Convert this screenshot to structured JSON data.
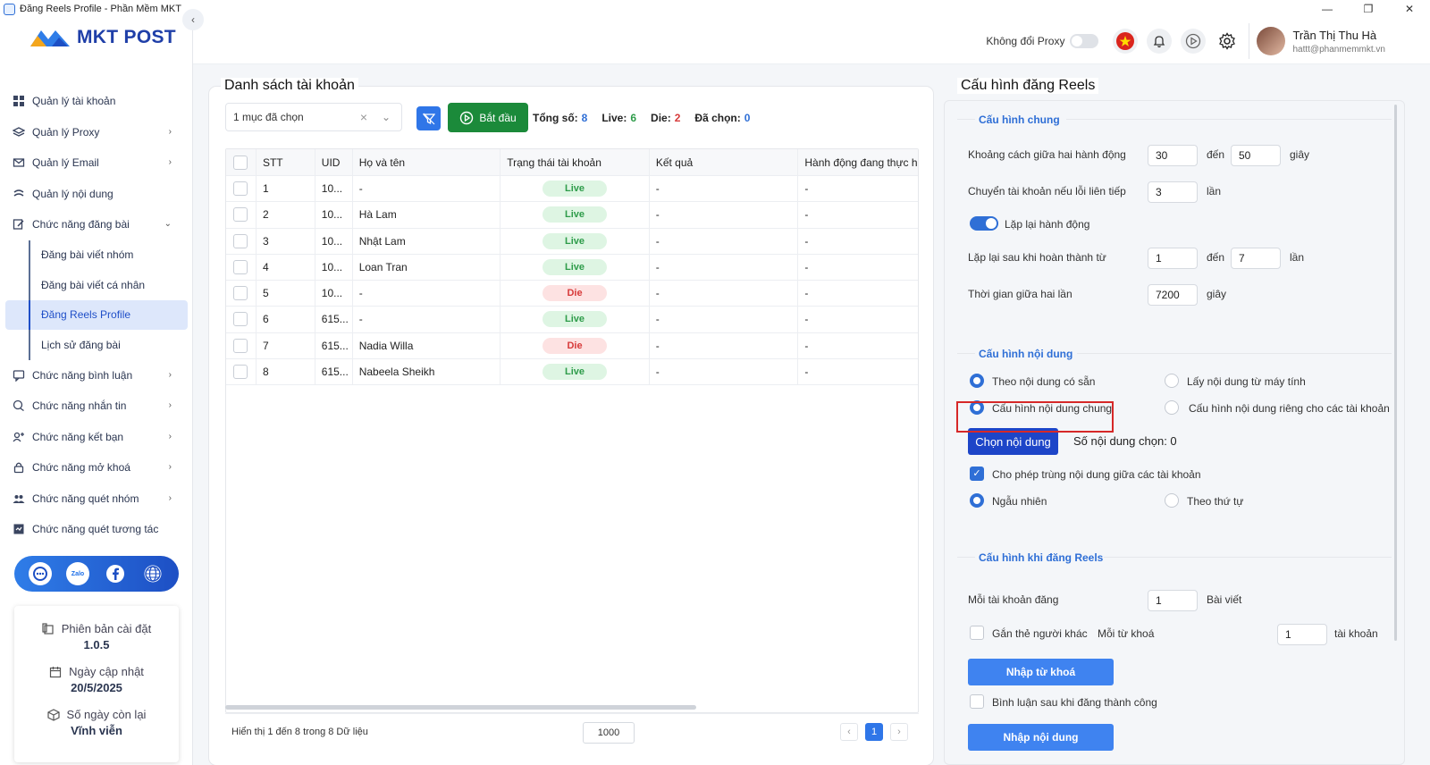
{
  "window": {
    "title": "Đăng Reels Profile - Phần Mềm MKT",
    "controls": [
      "—",
      "❐",
      "✕"
    ]
  },
  "brand": {
    "logo_text": "MKT POST",
    "colors": {
      "primary": "#2f6fd6",
      "green": "#1b8a3a",
      "live": "#2e9c4a",
      "die": "#d73a3a"
    }
  },
  "sidebar": {
    "items": [
      {
        "label": "Quản lý tài khoản",
        "icon": "grid-icon",
        "chevron": false
      },
      {
        "label": "Quản lý Proxy",
        "icon": "layers-icon",
        "chevron": true
      },
      {
        "label": "Quản lý Email",
        "icon": "mail-icon",
        "chevron": true
      },
      {
        "label": "Quản lý nội dung",
        "icon": "content-icon",
        "chevron": false
      },
      {
        "label": "Chức năng đăng bài",
        "icon": "edit-icon",
        "chevron": true,
        "expanded": true
      }
    ],
    "subitems": [
      {
        "label": "Đăng bài viết nhóm",
        "active": false
      },
      {
        "label": "Đăng bài viết cá nhân",
        "active": false
      },
      {
        "label": "Đăng Reels Profile",
        "active": true
      },
      {
        "label": "Lịch sử đăng bài",
        "active": false
      }
    ],
    "items2": [
      {
        "label": "Chức năng bình luận",
        "icon": "comment-icon",
        "chevron": true
      },
      {
        "label": "Chức năng nhắn tin",
        "icon": "chat-icon",
        "chevron": true
      },
      {
        "label": "Chức năng kết bạn",
        "icon": "user-add-icon",
        "chevron": true
      },
      {
        "label": "Chức năng mở khoá",
        "icon": "lock-icon",
        "chevron": true
      },
      {
        "label": "Chức năng quét nhóm",
        "icon": "group-icon",
        "chevron": true
      },
      {
        "label": "Chức năng quét tương tác",
        "icon": "scan-icon",
        "chevron": false
      }
    ],
    "social_zalo": "Zalo",
    "version": {
      "install_label": "Phiên bản cài đặt",
      "install_value": "1.0.5",
      "update_label": "Ngày cập nhật",
      "update_value": "20/5/2025",
      "days_label": "Số ngày còn lại",
      "days_value": "Vĩnh viễn"
    }
  },
  "header": {
    "proxy_label": "Không đổi Proxy",
    "user_name": "Trần Thị Thu Hà",
    "user_email": "hattt@phanmemmkt.vn"
  },
  "accounts": {
    "title": "Danh sách tài khoản",
    "filter_value": "1 mục đã chọn",
    "start_label": "Bắt đầu",
    "stats": {
      "total_label": "Tổng số:",
      "total": "8",
      "live_label": "Live:",
      "live": "6",
      "die_label": "Die:",
      "die": "2",
      "selected_label": "Đã chọn:",
      "selected": "0"
    },
    "columns": [
      "STT",
      "UID",
      "Họ và tên",
      "Trạng thái tài khoản",
      "Kết quả",
      "Hành động đang thực h"
    ],
    "rows": [
      {
        "stt": "1",
        "uid": "10...",
        "name": "-",
        "status": "Live",
        "result": "-",
        "action": "-"
      },
      {
        "stt": "2",
        "uid": "10...",
        "name": "Hà Lam",
        "status": "Live",
        "result": "-",
        "action": "-"
      },
      {
        "stt": "3",
        "uid": "10...",
        "name": "Nhật Lam",
        "status": "Live",
        "result": "-",
        "action": "-"
      },
      {
        "stt": "4",
        "uid": "10...",
        "name": "Loan Tran",
        "status": "Live",
        "result": "-",
        "action": "-"
      },
      {
        "stt": "5",
        "uid": "10...",
        "name": "-",
        "status": "Die",
        "result": "-",
        "action": "-"
      },
      {
        "stt": "6",
        "uid": "615...",
        "name": "-",
        "status": "Live",
        "result": "-",
        "action": "-"
      },
      {
        "stt": "7",
        "uid": "615...",
        "name": "Nadia Willa",
        "status": "Die",
        "result": "-",
        "action": "-"
      },
      {
        "stt": "8",
        "uid": "615...",
        "name": "Nabeela Sheikh",
        "status": "Live",
        "result": "-",
        "action": "-"
      }
    ],
    "footer_info": "Hiển thị 1 đến 8 trong 8 Dữ liệu",
    "page_size": "1000",
    "current_page": "1",
    "prev": "‹",
    "next": "›"
  },
  "config": {
    "title": "Cấu hình đăng Reels",
    "general": {
      "title": "Cấu hình chung",
      "delay_label": "Khoảng cách giữa hai hành động",
      "delay_from": "30",
      "to": "đến",
      "delay_to": "50",
      "sec": "giây",
      "switch_label": "Chuyển tài khoản nếu lỗi liên tiếp",
      "switch_value": "3",
      "times": "lần",
      "repeat_label": "Lặp lại hành động",
      "repeat_after_label": "Lặp lại sau khi hoàn thành từ",
      "repeat_from": "1",
      "repeat_to": "7",
      "interval_label": "Thời gian giữa hai lần",
      "interval_value": "7200"
    },
    "content": {
      "title": "Cấu hình nội dung",
      "opt_available": "Theo nội dung có sẵn",
      "opt_computer": "Lấy nội dung từ máy tính",
      "opt_common": "Cấu hình nội dung chung",
      "opt_separate": "Cấu hình nội dung riêng cho các tài khoản",
      "choose_btn": "Chọn nội dung",
      "count_label": "Số nội dung chọn: 0",
      "allow_dup": "Cho phép trùng nội dung giữa các tài khoản",
      "random": "Ngẫu nhiên",
      "ordered": "Theo thứ tự"
    },
    "reels": {
      "title": "Cấu hình khi đăng Reels",
      "per_account_label": "Mỗi tài khoản đăng",
      "per_account_value": "1",
      "post_unit": "Bài viết",
      "tag_label": "Gắn thẻ người khác",
      "per_keyword_label": "Mỗi từ khoá",
      "per_keyword_value": "1",
      "account_unit": "tài khoản",
      "keyword_btn": "Nhập từ khoá",
      "comment_label": "Bình luận sau khi đăng thành công",
      "content_btn": "Nhập nội dung"
    }
  }
}
